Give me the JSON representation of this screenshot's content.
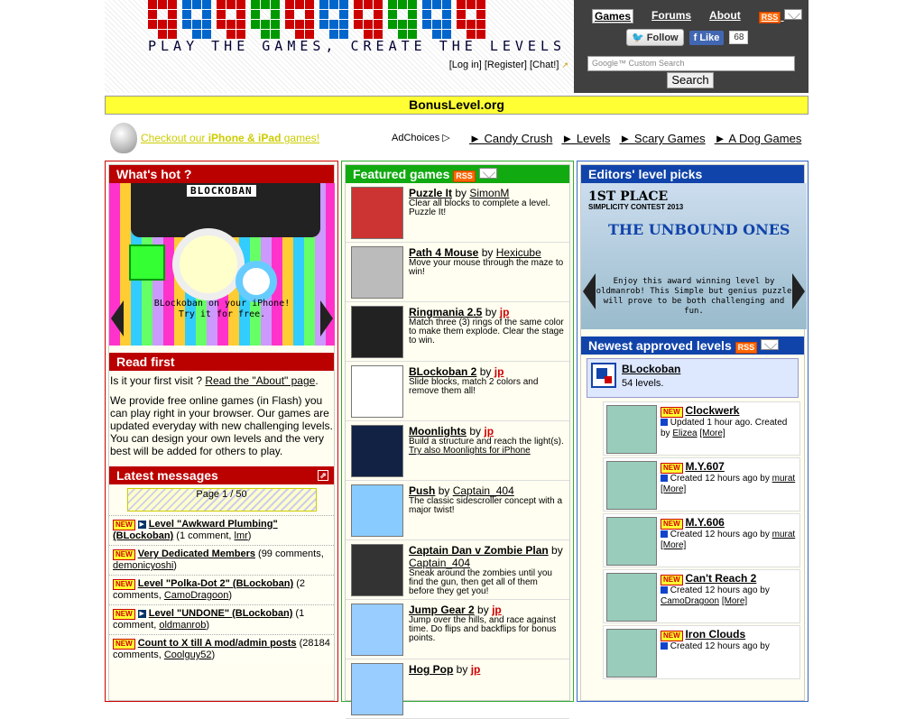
{
  "header": {
    "tagline": "PLAY THE GAMES,  CREATE THE LEVELS",
    "auth_links": [
      "[Log in]",
      "[Register]",
      "[Chat!]"
    ],
    "nav": [
      "Games",
      "Forums",
      "About"
    ],
    "rss_label": "RSS",
    "follow_label": "Follow",
    "like_label": "Like",
    "like_count": "68",
    "search_placeholder": "Google™ Custom Search",
    "search_button": "Search"
  },
  "banner": {
    "title": "BonusLevel.org"
  },
  "subbar": {
    "promo_prefix": "Checkout our",
    "promo_bold": "iPhone & iPad",
    "promo_suffix": "games!",
    "adchoices": "AdChoices",
    "links": [
      "► Candy Crush",
      "► Levels",
      "► Scary Games",
      "► A Dog Games"
    ]
  },
  "col1": {
    "whats_hot_title": "What's hot ?",
    "hot_logo": "BLOCKOBAN",
    "hot_caption_1": "BLockoban on your iPhone!",
    "hot_caption_2": "Try it for free.",
    "read_first_title": "Read first",
    "read_first_q": "Is it your first visit ?",
    "read_first_link": "Read the \"About\" page",
    "read_first_body": "We provide free online games (in Flash) you can play right in your browser. Our games are updated everyday with new challenging levels. You can design your own levels and the very best will be added for others to play.",
    "latest_title": "Latest messages",
    "pager": "Page 1 / 50",
    "new_label": "NEW",
    "messages": [
      {
        "title": "Level \"Awkward Plumbing\" (BLockoban)",
        "meta": "(1 comment,",
        "user": "lmr"
      },
      {
        "title": "Very Dedicated Members",
        "meta": "(99 comments,",
        "user": "demonicyoshi"
      },
      {
        "title": "Level \"Polka-Dot 2\" (BLockoban)",
        "meta": "(2 comments,",
        "user": "CamoDragoon"
      },
      {
        "title": "Level \"UNDONE\" (BLockoban)",
        "meta": "(1 comment,",
        "user": "oldmanrob"
      },
      {
        "title": "Count to X till A mod/admin posts",
        "meta": "(28184 comments,",
        "user": "Coolguy52"
      }
    ]
  },
  "col2": {
    "title": "Featured games",
    "games": [
      {
        "title": "Puzzle It",
        "by": "by",
        "author": "SimonM",
        "desc": "Clear all blocks to complete a level. Puzzle It!",
        "extra": ""
      },
      {
        "title": "Path 4 Mouse",
        "by": "by",
        "author": "Hexicube",
        "desc": "Move your mouse through the maze to win!",
        "extra": ""
      },
      {
        "title": "Ringmania 2.5",
        "by": "by",
        "author": "jp",
        "desc": "Match three (3) rings of the same color to make them explode. Clear the stage to win.",
        "extra": ""
      },
      {
        "title": "BLockoban 2",
        "by": "by",
        "author": "jp",
        "desc": "Slide blocks, match 2 colors and remove them all!",
        "extra": ""
      },
      {
        "title": "Moonlights",
        "by": "by",
        "author": "jp",
        "desc": "Build a structure and reach the light(s).",
        "extra": "Try also Moonlights for iPhone"
      },
      {
        "title": "Push",
        "by": "by",
        "author": "Captain_404",
        "desc": "The classic sidescroller concept with a major twist!",
        "extra": ""
      },
      {
        "title": "Captain Dan v Zombie Plan",
        "by": "by",
        "author": "Captain_404",
        "desc": "Sneak around the zombies until you find the gun, then get all of them before they get you!",
        "extra": ""
      },
      {
        "title": "Jump Gear 2",
        "by": "by",
        "author": "jp",
        "desc": "Jump over the hills, and race against time. Do flips and backflips for bonus points.",
        "extra": ""
      },
      {
        "title": "Hog Pop",
        "by": "by",
        "author": "jp",
        "desc": "",
        "extra": ""
      }
    ]
  },
  "col3": {
    "editors_title": "Editors' level picks",
    "ed_place": "1ST PLACE",
    "ed_contest": "SIMPLICITY CONTEST 2013",
    "ed_name": "THE UNBOUND ONES",
    "ed_caption": "Enjoy this award winning level by oldmanrob! This Simple but genius puzzle will prove to be both challenging and fun.",
    "newest_title": "Newest approved levels",
    "pack_name": "BLockoban",
    "pack_count": "54 levels.",
    "levels": [
      {
        "name": "Clockwerk",
        "status": "Updated 1 hour ago. Created by",
        "user": "Elizea",
        "more": "[More]"
      },
      {
        "name": "M.Y.607",
        "status": "Created 12 hours ago by",
        "user": "murat",
        "more": "[More]"
      },
      {
        "name": "M.Y.606",
        "status": "Created 12 hours ago by",
        "user": "murat",
        "more": "[More]"
      },
      {
        "name": "Can't Reach 2",
        "status": "Created 12 hours ago by",
        "user": "CamoDragoon",
        "more": "[More]"
      },
      {
        "name": "Iron Clouds",
        "status": "Created 12 hours ago by",
        "user": "",
        "more": ""
      }
    ]
  },
  "colors": {
    "red_head": "#bb0000",
    "green_head": "#11aa11",
    "blue_head": "#1144aa",
    "banner": "#ffff33"
  }
}
